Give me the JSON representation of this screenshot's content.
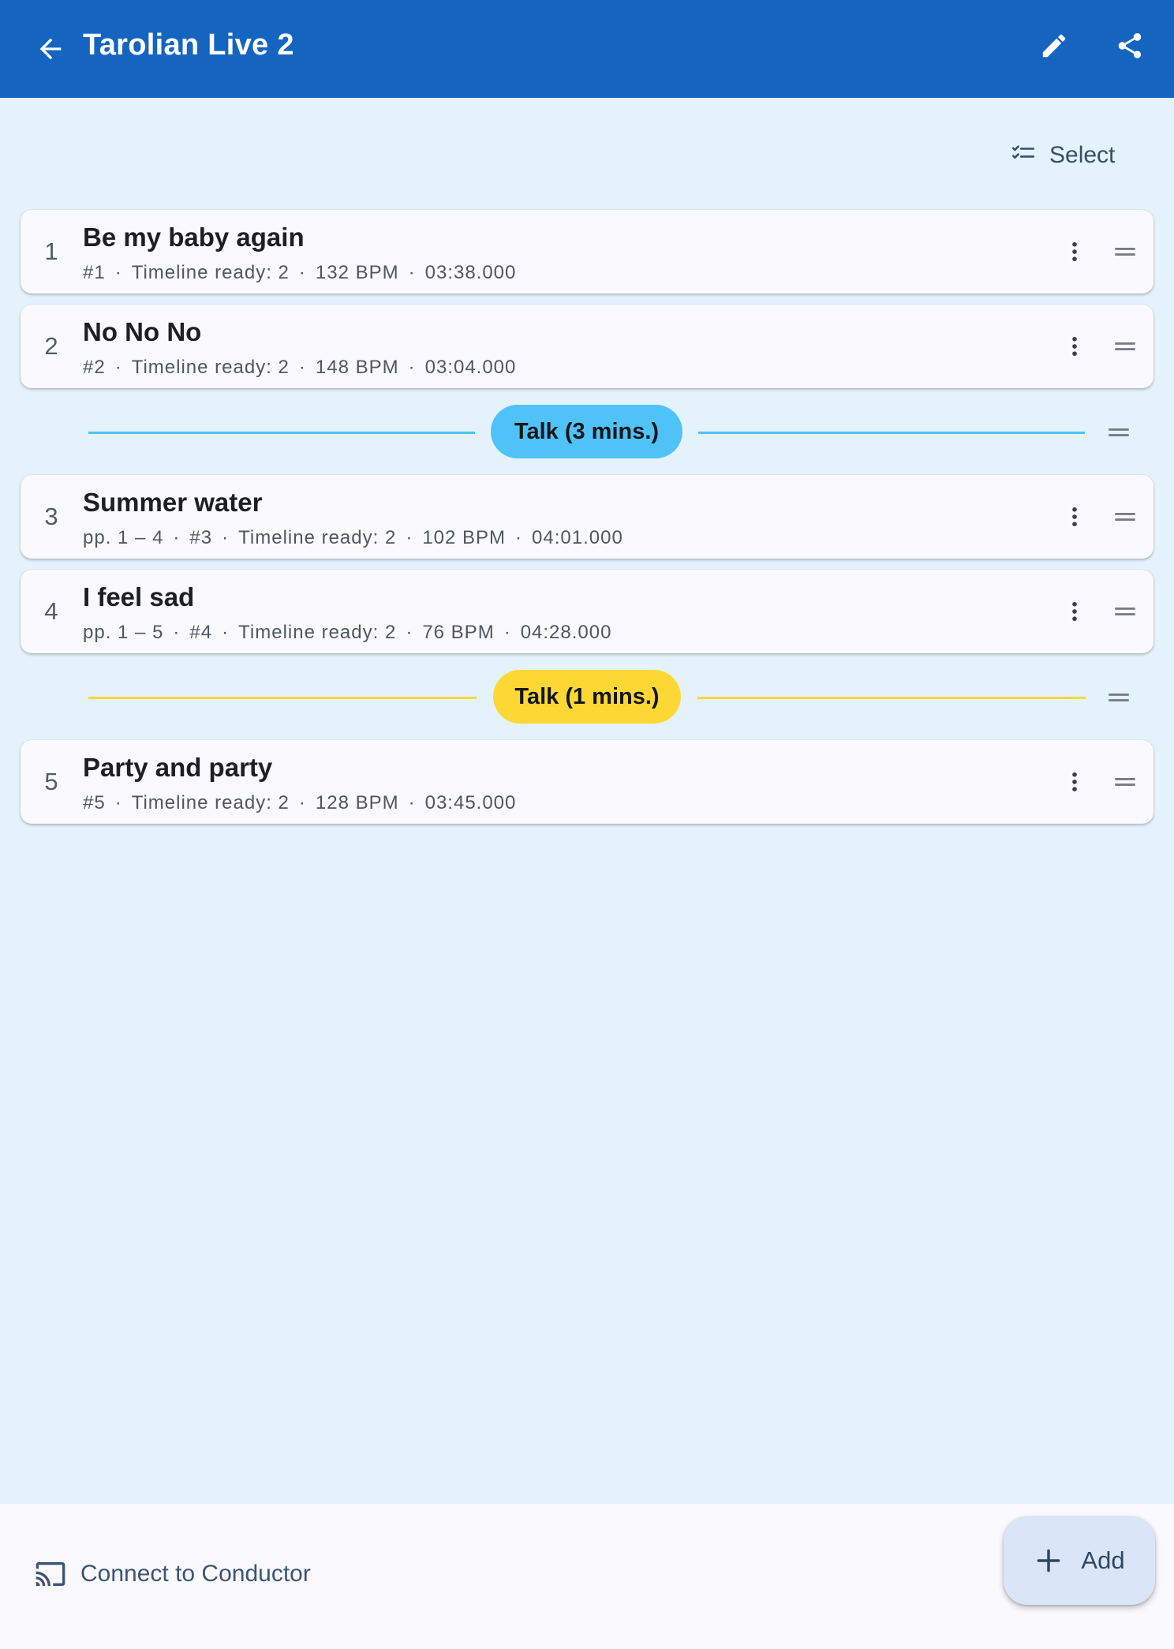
{
  "appbar": {
    "title": "Tarolian Live 2",
    "back_icon": "arrow-left-icon",
    "edit_icon": "pencil-icon",
    "share_icon": "share-icon",
    "bg_color": "#1565c0"
  },
  "toolbar": {
    "select_label": "Select",
    "select_icon": "checklist-icon"
  },
  "setlist": {
    "songs": [
      {
        "index": "1",
        "title": "Be my baby again",
        "meta": [
          "#1",
          "Timeline ready: 2",
          "132 BPM",
          "03:38.000"
        ]
      },
      {
        "index": "2",
        "title": "No No No",
        "meta": [
          "#2",
          "Timeline ready: 2",
          "148 BPM",
          "03:04.000"
        ]
      },
      {
        "index": "3",
        "title": "Summer water",
        "meta": [
          "pp. 1 – 4",
          "#3",
          "Timeline ready: 2",
          "102 BPM",
          "04:01.000"
        ]
      },
      {
        "index": "4",
        "title": "I feel sad",
        "meta": [
          "pp. 1 – 5",
          "#4",
          "Timeline ready: 2",
          "76 BPM",
          "04:28.000"
        ]
      },
      {
        "index": "5",
        "title": "Party and party",
        "meta": [
          "#5",
          "Timeline ready: 2",
          "128 BPM",
          "03:45.000"
        ]
      }
    ],
    "talks": [
      {
        "label": "Talk (3 mins.)",
        "color": "#4fc3f7"
      },
      {
        "label": "Talk (1 mins.)",
        "color": "#fdd835"
      }
    ]
  },
  "bottombar": {
    "connect_label": "Connect to Conductor",
    "connect_icon": "cast-icon",
    "add_label": "Add",
    "add_icon": "plus-icon"
  }
}
